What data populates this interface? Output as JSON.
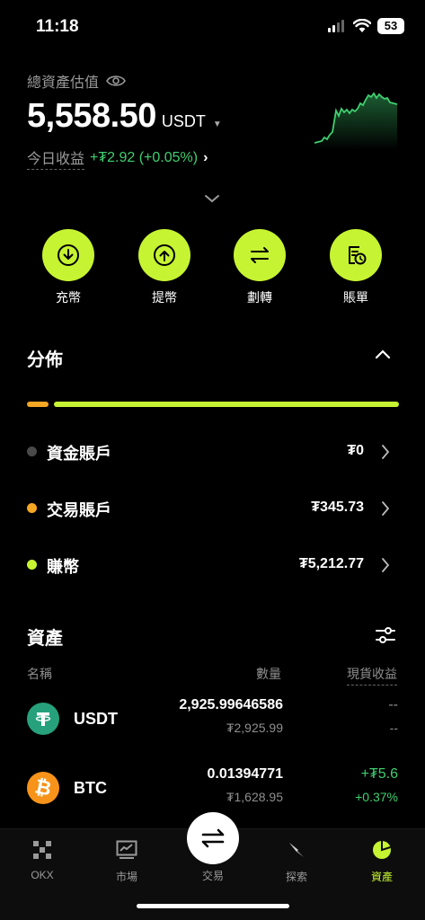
{
  "status": {
    "time": "11:18",
    "battery": "53"
  },
  "header": {
    "label": "總資產估值",
    "value": "5,558.50",
    "unit": "USDT",
    "pnl_label": "今日收益",
    "pnl_value": "+₮2.92 (+0.05%)"
  },
  "actions": [
    {
      "label": "充幣",
      "icon": "deposit-icon"
    },
    {
      "label": "提幣",
      "icon": "withdraw-icon"
    },
    {
      "label": "劃轉",
      "icon": "transfer-icon"
    },
    {
      "label": "賬單",
      "icon": "bill-icon"
    }
  ],
  "distribution": {
    "title": "分佈",
    "accounts": [
      {
        "name": "資金賬戶",
        "amount": "₮0",
        "color": "#4a4a4a"
      },
      {
        "name": "交易賬戶",
        "amount": "₮345.73",
        "color": "#f5a623"
      },
      {
        "name": "賺幣",
        "amount": "₮5,212.77",
        "color": "#c6f432"
      }
    ]
  },
  "assets": {
    "title": "資產",
    "col_name": "名稱",
    "col_qty": "數量",
    "col_pnl": "現貨收益",
    "rows": [
      {
        "symbol": "USDT",
        "qty": "2,925.99646586",
        "fiat": "₮2,925.99",
        "pnl": "--",
        "pnl_pct": "--",
        "logo": "tether-icon"
      },
      {
        "symbol": "BTC",
        "qty": "0.01394771",
        "fiat": "₮1,628.95",
        "pnl": "+₮5.6",
        "pnl_pct": "+0.37%",
        "logo": "bitcoin-icon"
      }
    ]
  },
  "tabs": [
    {
      "label": "OKX",
      "icon": "okx-logo-icon"
    },
    {
      "label": "市場",
      "icon": "market-chart-icon"
    },
    {
      "label": "交易",
      "icon": "swap-arrows-icon"
    },
    {
      "label": "探索",
      "icon": "compass-icon"
    },
    {
      "label": "資產",
      "icon": "pie-chart-icon"
    }
  ],
  "colors": {
    "accent": "#c6f432",
    "profit": "#3fcf6f",
    "orange": "#f5a623"
  }
}
